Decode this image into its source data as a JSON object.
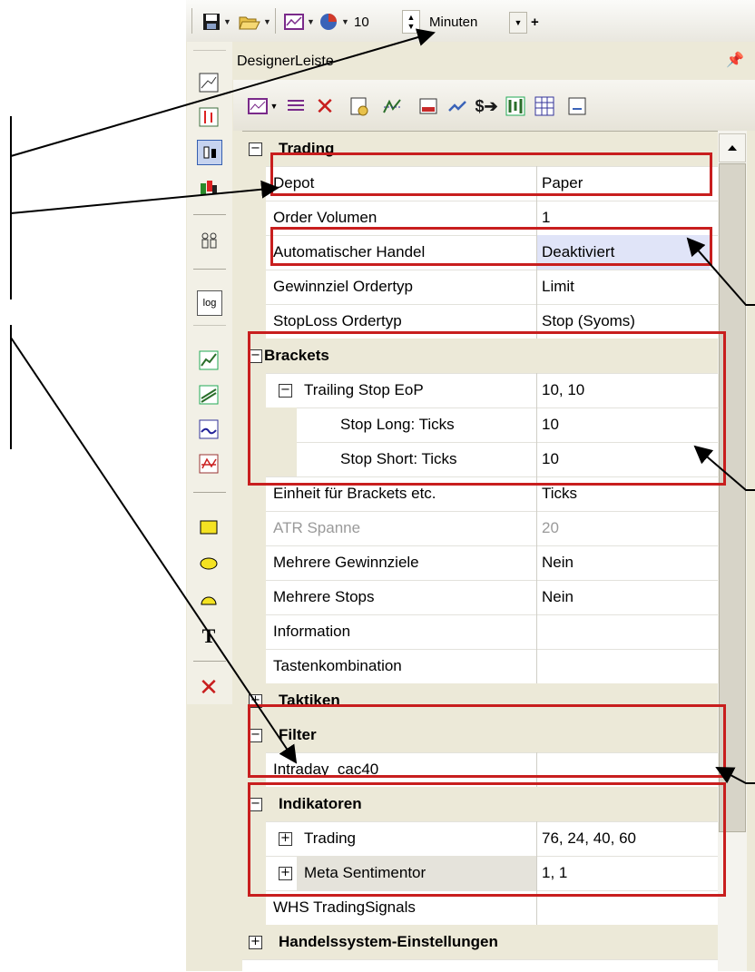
{
  "toolbar": {
    "interval_value": "10",
    "interval_unit": "Minuten",
    "extra": "+"
  },
  "panel": {
    "title": "DesignerLeiste",
    "pin_icon": "pin-icon"
  },
  "vertical_tools": {
    "text_tool_label": "T",
    "log_label": "log"
  },
  "grid": {
    "cat_trading": "Trading",
    "depot_label": "Depot",
    "depot_value": "Paper",
    "order_label": "Order Volumen",
    "order_value": "1",
    "auto_label": "Automatischer Handel",
    "auto_value": "Deaktiviert",
    "gewinn_label": "Gewinnziel Ordertyp",
    "gewinn_value": "Limit",
    "stoploss_label": "StopLoss Ordertyp",
    "stoploss_value": "Stop (Syoms)",
    "cat_brackets": "Brackets",
    "trailing_label": "Trailing Stop EoP",
    "trailing_value": "10, 10",
    "stoplong_label": "Stop Long: Ticks",
    "stoplong_value": "10",
    "stopshort_label": "Stop Short: Ticks",
    "stopshort_value": "10",
    "einheit_label": "Einheit für Brackets etc.",
    "einheit_value": "Ticks",
    "atr_label": "ATR Spanne",
    "atr_value": "20",
    "mehrgew_label": "Mehrere Gewinnziele",
    "mehrgew_value": "Nein",
    "mehrstop_label": "Mehrere Stops",
    "mehrstop_value": "Nein",
    "info_label": "Information",
    "tasten_label": "Tastenkombination",
    "cat_taktiken": "Taktiken",
    "cat_filter": "Filter",
    "intraday_label": "Intraday_cac40",
    "cat_indikatoren": "Indikatoren",
    "ind_trading_label": "Trading",
    "ind_trading_value": "76, 24, 40, 60",
    "meta_label": "Meta Sentimentor",
    "meta_value": "1, 1",
    "whs_label": "WHS TradingSignals",
    "cat_handels": "Handelssystem-Einstellungen"
  },
  "colors": {
    "highlight_box": "#c81e1e",
    "selected_value_bg": "#e0e4f8",
    "category_bg": "#ece9d8"
  }
}
